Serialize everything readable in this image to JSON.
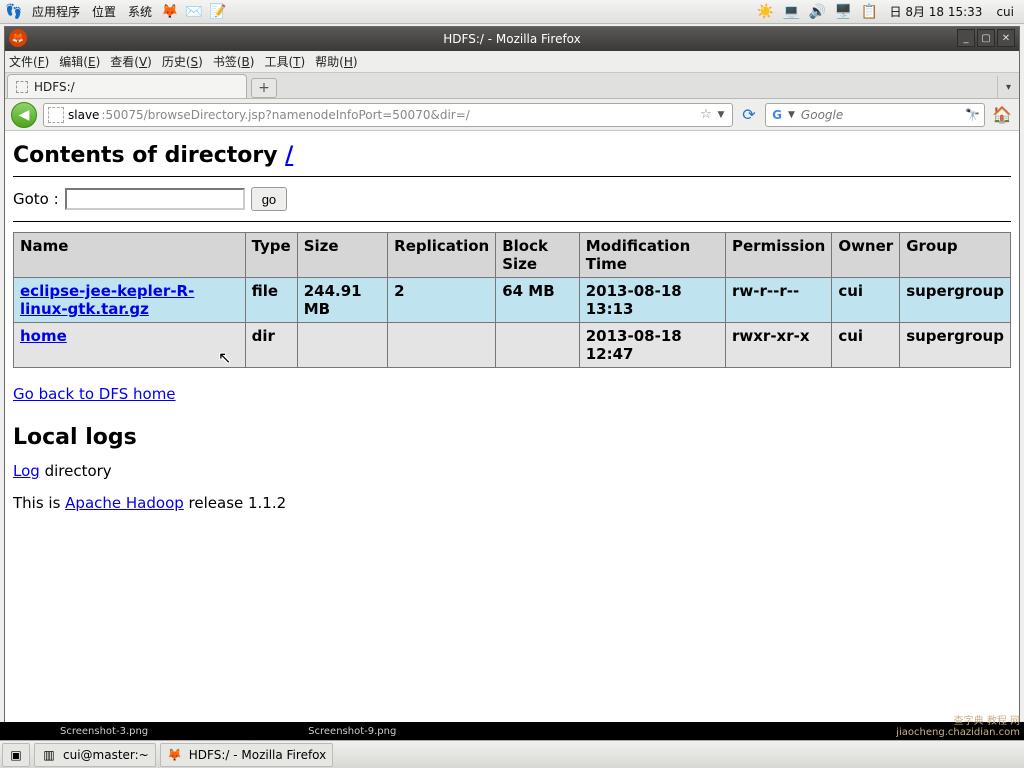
{
  "gnome_panel": {
    "menus": [
      "应用程序",
      "位置",
      "系统"
    ],
    "clock": "日 8月 18 15:33",
    "user": "cui"
  },
  "window_title": "HDFS:/ - Mozilla Firefox",
  "firefox_menu": [
    "文件(F)",
    "编辑(E)",
    "查看(V)",
    "历史(S)",
    "书签(B)",
    "工具(T)",
    "帮助(H)"
  ],
  "tab_label": "HDFS:/",
  "url": "slave:50075/browseDirectory.jsp?namenodeInfoPort=50070&dir=/",
  "search_placeholder": "Google",
  "page": {
    "heading_prefix": "Contents of directory ",
    "heading_link": "/",
    "goto_label": "Goto :",
    "go_button": "go",
    "columns": [
      "Name",
      "Type",
      "Size",
      "Replication",
      "Block Size",
      "Modification Time",
      "Permission",
      "Owner",
      "Group"
    ],
    "rows": [
      {
        "name": "eclipse-jee-kepler-R-linux-gtk.tar.gz",
        "type": "file",
        "size": "244.91 MB",
        "replication": "2",
        "block_size": "64 MB",
        "mod_time": "2013-08-18 13:13",
        "permission": "rw-r--r--",
        "owner": "cui",
        "group": "supergroup",
        "highlight": true
      },
      {
        "name": "home",
        "type": "dir",
        "size": "",
        "replication": "",
        "block_size": "",
        "mod_time": "2013-08-18 12:47",
        "permission": "rwxr-xr-x",
        "owner": "cui",
        "group": "supergroup",
        "highlight": false
      }
    ],
    "back_link": "Go back to DFS home",
    "local_logs_heading": "Local logs",
    "log_link": "Log",
    "log_suffix": " directory",
    "footer_prefix": "This is ",
    "footer_link": "Apache Hadoop",
    "footer_suffix": " release 1.1.2"
  },
  "bg_thumbs": [
    "Screenshot-3.png",
    "Screenshot-9.png"
  ],
  "taskbar": {
    "task1": "cui@master:~",
    "task2": "HDFS:/ - Mozilla Firefox"
  },
  "watermark": "查字典 教程 网\njiaocheng.chazidian.com"
}
